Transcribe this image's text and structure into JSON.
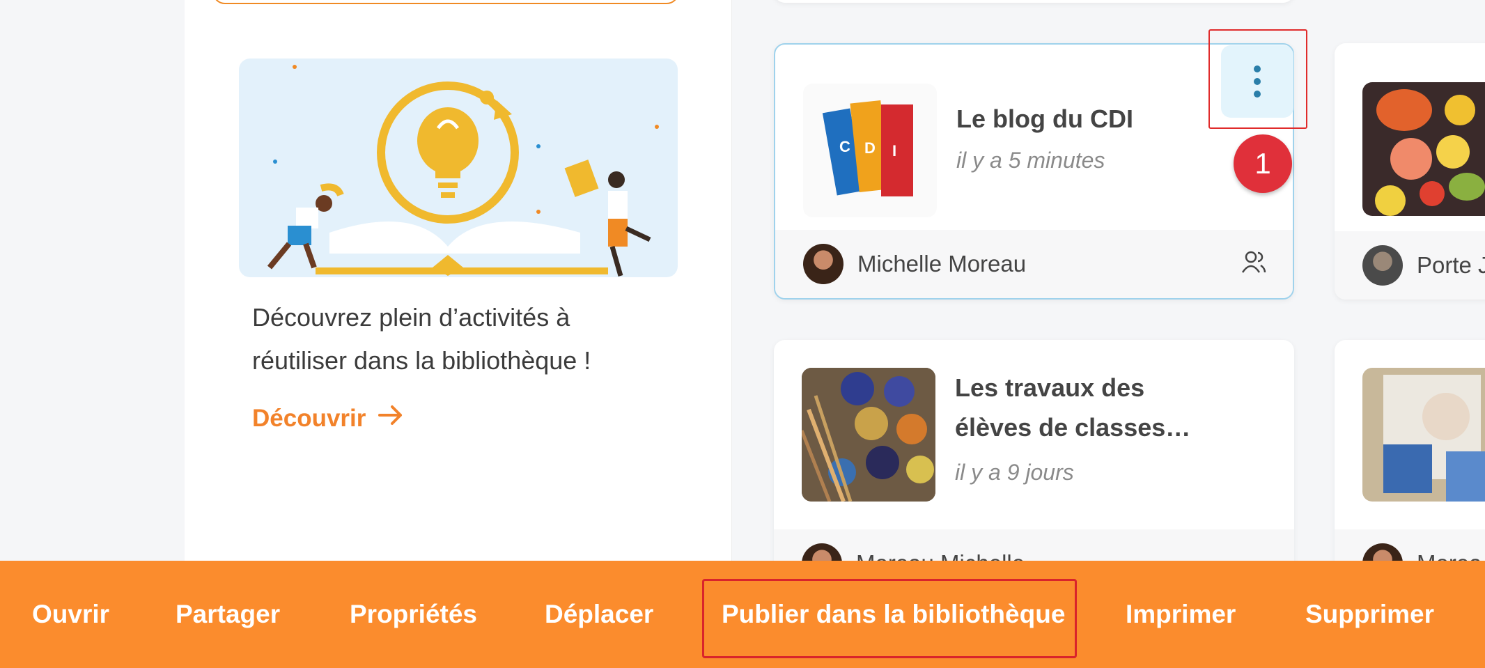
{
  "promo": {
    "text_line1": "Découvrez plein d’activités à",
    "text_line2": "réutiliser dans la bibliothèque !",
    "link_label": "Découvrir"
  },
  "cards": [
    {
      "title": "Le blog du CDI",
      "time": "il y a 5 minutes",
      "author": "Michelle Moreau",
      "thumb_text": "C D I"
    },
    {
      "title_line1": "Les travaux des",
      "title_line2": "élèves de classes…",
      "time": "il y a 9 jours",
      "author": "Moreau Michelle"
    }
  ],
  "right_cards": [
    {
      "author": "Porte J"
    },
    {
      "author": "Morea"
    }
  ],
  "step_badge": "1",
  "toolbar": {
    "open": "Ouvrir",
    "share": "Partager",
    "properties": "Propriétés",
    "move": "Déplacer",
    "publish": "Publier dans la bibliothèque",
    "print": "Imprimer",
    "delete": "Supprimer"
  },
  "colors": {
    "accent_orange": "#fb8c2d",
    "link_orange": "#f2822a",
    "highlight_red": "#e02b2b",
    "menu_blue": "#2a7ea9"
  }
}
